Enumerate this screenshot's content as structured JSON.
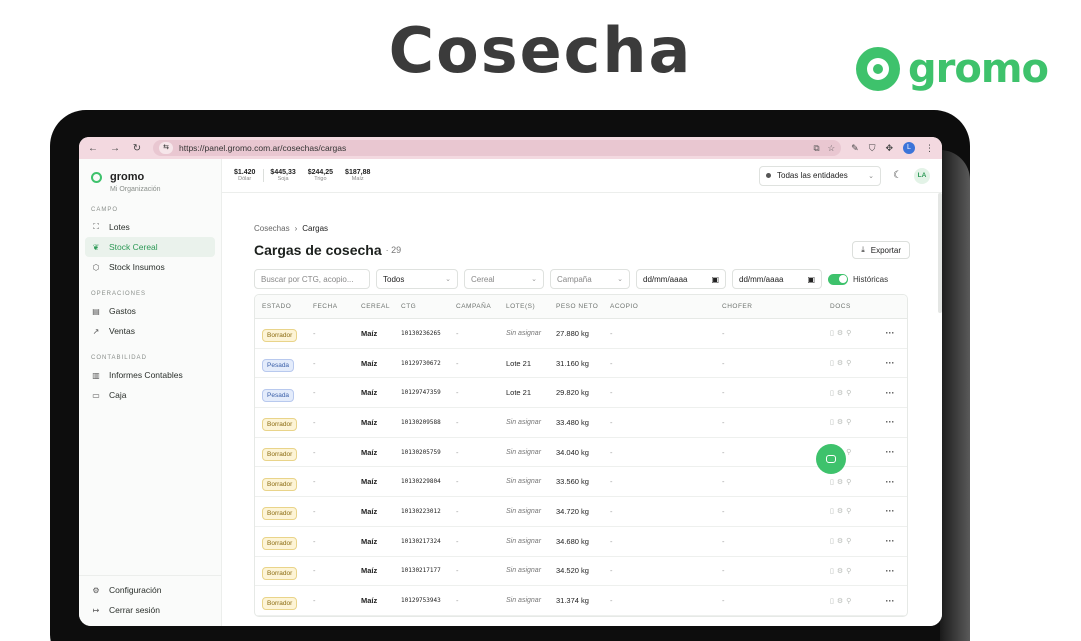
{
  "hero": {
    "title": "Cosecha",
    "brand": "gromo"
  },
  "browser": {
    "url": "https://panel.gromo.com.ar/cosechas/cargas",
    "profile": "L"
  },
  "sidebar": {
    "brand": "gromo",
    "org": "Mi Organización",
    "sections": [
      {
        "label": "CAMPO",
        "items": [
          {
            "label": "Lotes",
            "icon": "map-icon",
            "glyph": "⛶",
            "active": false
          },
          {
            "label": "Stock Cereal",
            "icon": "leaf-icon",
            "glyph": "❦",
            "active": true
          },
          {
            "label": "Stock Insumos",
            "icon": "box-icon",
            "glyph": "⬡",
            "active": false
          }
        ]
      },
      {
        "label": "OPERACIONES",
        "items": [
          {
            "label": "Gastos",
            "icon": "receipt-icon",
            "glyph": "▤",
            "active": false
          },
          {
            "label": "Ventas",
            "icon": "trend-icon",
            "glyph": "↗",
            "active": false
          }
        ]
      },
      {
        "label": "CONTABILIDAD",
        "items": [
          {
            "label": "Informes Contables",
            "icon": "report-icon",
            "glyph": "▥",
            "active": false
          },
          {
            "label": "Caja",
            "icon": "wallet-icon",
            "glyph": "▭",
            "active": false
          }
        ]
      }
    ],
    "bottom": [
      {
        "label": "Configuración",
        "icon": "gear-icon",
        "glyph": "⚙"
      },
      {
        "label": "Cerrar sesión",
        "icon": "logout-icon",
        "glyph": "↦"
      }
    ]
  },
  "ticker": [
    {
      "value": "$1.420",
      "label": "Dólar"
    },
    {
      "value": "$445,33",
      "label": "Soja"
    },
    {
      "value": "$244,25",
      "label": "Trigo"
    },
    {
      "value": "$187,88",
      "label": "Maíz"
    }
  ],
  "topbar": {
    "entity": "Todas las entidades",
    "avatar": "LA"
  },
  "page": {
    "breadcrumb_parent": "Cosechas",
    "breadcrumb_current": "Cargas",
    "title": "Cargas de cosecha",
    "count": "· 29",
    "export_label": "Exportar"
  },
  "filters": {
    "search_placeholder": "Buscar por CTG, acopio...",
    "estado": "Todos",
    "cereal": "Cereal",
    "campana": "Campaña",
    "date_from": "dd/mm/aaaa",
    "date_to": "dd/mm/aaaa",
    "historicas": "Históricas"
  },
  "table": {
    "headers": [
      "ESTADO",
      "FECHA",
      "CEREAL",
      "CTG",
      "CAMPAÑA",
      "LOTE(S)",
      "PESO NETO",
      "ACOPIO",
      "CHOFER",
      "DOCS"
    ],
    "rows": [
      {
        "estado": "Borrador",
        "fecha": "-",
        "cereal": "Maíz",
        "ctg": "10130236265",
        "campana": "-",
        "lote": "Sin asignar",
        "peso": "27.880 kg",
        "acopio": "-",
        "chofer": "-"
      },
      {
        "estado": "Pesada",
        "fecha": "-",
        "cereal": "Maíz",
        "ctg": "10129730672",
        "campana": "-",
        "lote": "Lote 21",
        "peso": "31.160 kg",
        "acopio": "-",
        "chofer": "-"
      },
      {
        "estado": "Pesada",
        "fecha": "-",
        "cereal": "Maíz",
        "ctg": "10129747359",
        "campana": "-",
        "lote": "Lote 21",
        "peso": "29.820 kg",
        "acopio": "-",
        "chofer": "-"
      },
      {
        "estado": "Borrador",
        "fecha": "-",
        "cereal": "Maíz",
        "ctg": "10130209588",
        "campana": "-",
        "lote": "Sin asignar",
        "peso": "33.480 kg",
        "acopio": "-",
        "chofer": "-"
      },
      {
        "estado": "Borrador",
        "fecha": "-",
        "cereal": "Maíz",
        "ctg": "10130205759",
        "campana": "-",
        "lote": "Sin asignar",
        "peso": "34.040 kg",
        "acopio": "-",
        "chofer": "-"
      },
      {
        "estado": "Borrador",
        "fecha": "-",
        "cereal": "Maíz",
        "ctg": "10130229804",
        "campana": "-",
        "lote": "Sin asignar",
        "peso": "33.560 kg",
        "acopio": "-",
        "chofer": "-"
      },
      {
        "estado": "Borrador",
        "fecha": "-",
        "cereal": "Maíz",
        "ctg": "10130223012",
        "campana": "-",
        "lote": "Sin asignar",
        "peso": "34.720 kg",
        "acopio": "-",
        "chofer": "-"
      },
      {
        "estado": "Borrador",
        "fecha": "-",
        "cereal": "Maíz",
        "ctg": "10130217324",
        "campana": "-",
        "lote": "Sin asignar",
        "peso": "34.680 kg",
        "acopio": "-",
        "chofer": "-"
      },
      {
        "estado": "Borrador",
        "fecha": "-",
        "cereal": "Maíz",
        "ctg": "10130217177",
        "campana": "-",
        "lote": "Sin asignar",
        "peso": "34.520 kg",
        "acopio": "-",
        "chofer": "-"
      },
      {
        "estado": "Borrador",
        "fecha": "-",
        "cereal": "Maíz",
        "ctg": "10129753943",
        "campana": "-",
        "lote": "Sin asignar",
        "peso": "31.374 kg",
        "acopio": "-",
        "chofer": "-"
      }
    ]
  },
  "colors": {
    "brand": "#3ec26c",
    "borrador": "#fdf4d6",
    "pesada": "#e4ecfb"
  }
}
